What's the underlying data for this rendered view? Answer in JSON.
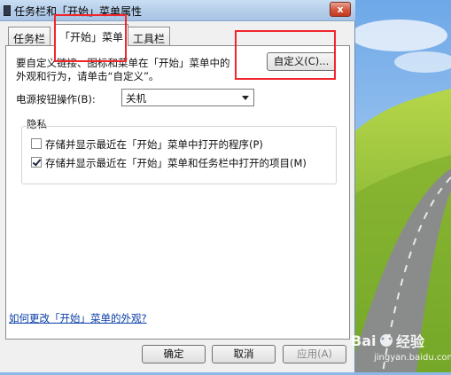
{
  "window": {
    "title": "任务栏和「开始」菜单属性",
    "close_glyph": "x"
  },
  "tabs": [
    {
      "label": "任务栏",
      "active": false
    },
    {
      "label": "「开始」菜单",
      "active": true
    },
    {
      "label": "工具栏",
      "active": false
    }
  ],
  "start_menu": {
    "description_line1": "要自定义链接、图标和菜单在「开始」菜单中的",
    "description_line2": "外观和行为，请单击“自定义”。",
    "customize_button": "自定义(C)...",
    "power_button_label": "电源按钮操作(B):",
    "power_button_value": "关机",
    "privacy_group_label": "隐私",
    "privacy_options": [
      {
        "label": "存储并显示最近在「开始」菜单中打开的程序(P)",
        "checked": false
      },
      {
        "label": "存储并显示最近在「开始」菜单和任务栏中打开的项目(M)",
        "checked": true
      }
    ],
    "help_link": "如何更改「开始」菜单的外观?"
  },
  "dialog_buttons": {
    "ok": "确定",
    "cancel": "取消",
    "apply": "应用(A)"
  },
  "watermark": {
    "text": "经验",
    "url": "jingyan.baidu.com"
  },
  "colors": {
    "annotation_red": "#f0262b",
    "window_bg": "#f0f0f0",
    "link_blue": "#0a3ea8"
  }
}
